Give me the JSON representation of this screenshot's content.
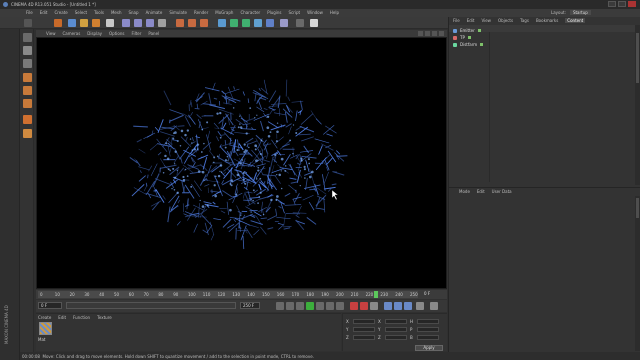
{
  "window": {
    "title": "CINEMA 4D R13.051 Studio - [Untitled 1 *]"
  },
  "menubar": {
    "items": [
      "File",
      "Edit",
      "Create",
      "Select",
      "Tools",
      "Mesh",
      "Snap",
      "Animate",
      "Simulate",
      "Render",
      "MoGraph",
      "Character",
      "Plugins",
      "Script",
      "Window",
      "Help"
    ],
    "layout_label": "Layout:",
    "layout_value": "Startup"
  },
  "viewport": {
    "menu": [
      "View",
      "Cameras",
      "Display",
      "Options",
      "Filter",
      "Panel"
    ],
    "cursor_icon": "mouse-pointer-icon"
  },
  "timeline": {
    "ticks": [
      "0",
      "10",
      "20",
      "30",
      "40",
      "50",
      "60",
      "70",
      "80",
      "90",
      "100",
      "110",
      "120",
      "130",
      "140",
      "150",
      "160",
      "170",
      "180",
      "190",
      "200",
      "210",
      "220",
      "230",
      "240",
      "250"
    ],
    "current": "228 F",
    "end": "0 F"
  },
  "playbar": {
    "start_field": "0 F",
    "min_field": "0 F",
    "max_field": "250 F",
    "end_field": "250 F"
  },
  "material_manager": {
    "menu": [
      "Create",
      "Edit",
      "Function",
      "Texture"
    ],
    "material_name": "Mat"
  },
  "coordinates": {
    "rows": [
      {
        "axis": "X",
        "pos": "",
        "size": "",
        "rot": "H"
      },
      {
        "axis": "Y",
        "pos": "",
        "size": "",
        "rot": "P"
      },
      {
        "axis": "Z",
        "pos": "",
        "size": "",
        "rot": "B"
      }
    ],
    "apply_label": "Apply"
  },
  "object_manager": {
    "tabs": [
      "File",
      "Edit",
      "View",
      "Objects",
      "Tags",
      "Bookmarks"
    ],
    "active_tab": "Content",
    "objects": [
      {
        "name": "Emitter",
        "color": "#6a9ad8"
      },
      {
        "name": "TP",
        "color": "#d86a6a"
      },
      {
        "name": "Distfarm",
        "color": "#6ad8a0"
      }
    ]
  },
  "attribute_manager": {
    "menu": [
      "Mode",
      "Edit",
      "User Data"
    ]
  },
  "statusbar": {
    "time": "00:00:08",
    "text": "Move: Click and drag to move elements. Hold down SHIFT to quantize movement / add to the selection in point mode, CTRL to remove."
  },
  "brand": "MAXON CINEMA 4D"
}
